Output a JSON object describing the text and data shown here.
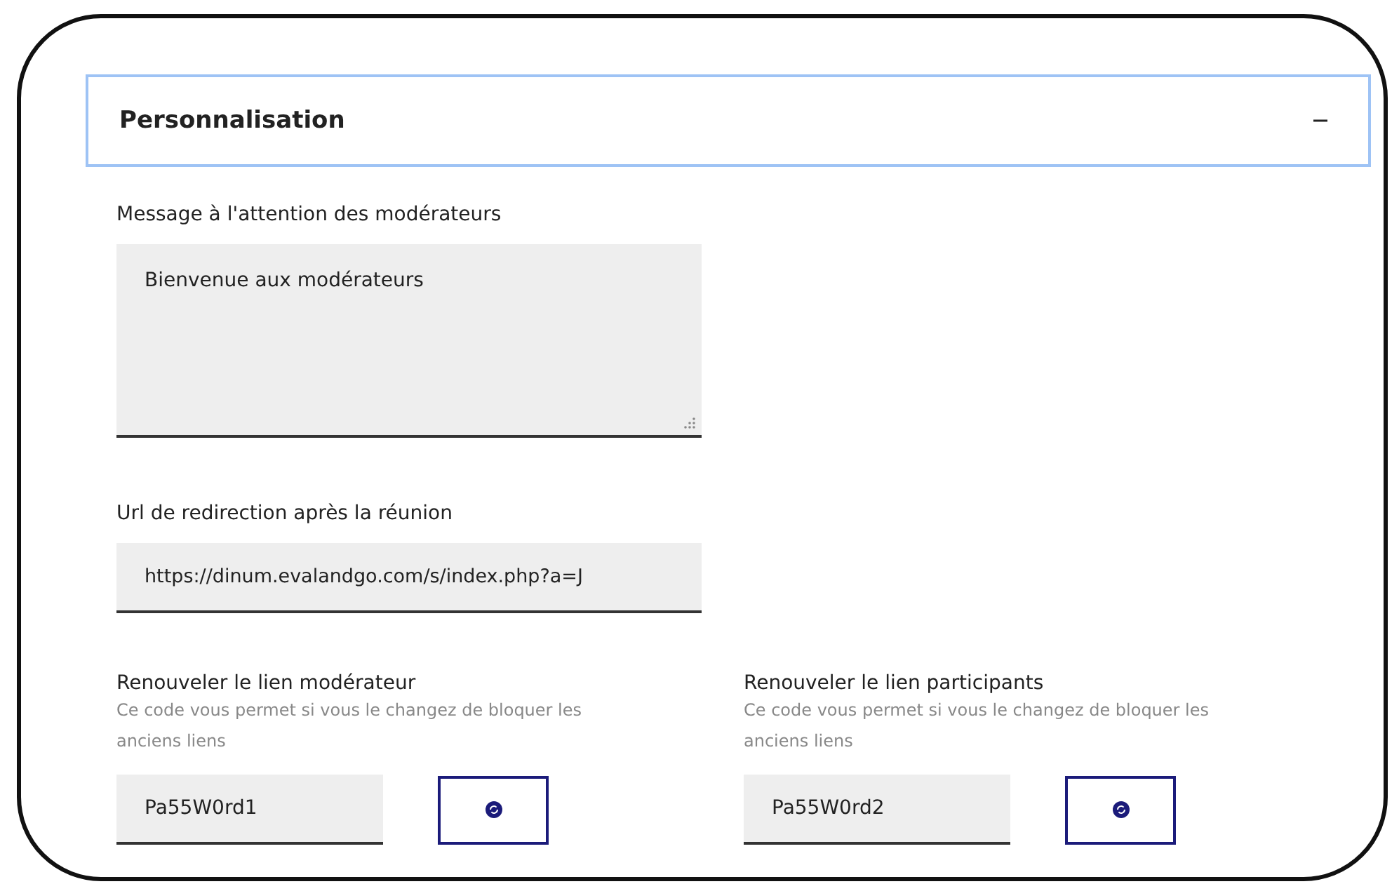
{
  "accordion": {
    "title": "Personnalisation",
    "expanded": true
  },
  "moderator_message": {
    "label": "Message à l'attention des modérateurs",
    "value": "Bienvenue aux modérateurs"
  },
  "redirect_url": {
    "label": "Url de redirection après la réunion",
    "value": "https://dinum.evalandgo.com/s/index.php?a=J"
  },
  "renew_links": [
    {
      "label": "Renouveler le lien modérateur",
      "hint": "Ce code vous permet si vous le changez de bloquer les anciens liens",
      "value": "Pa55W0rd1"
    },
    {
      "label": "Renouveler le lien participants",
      "hint": "Ce code vous permet si vous le changez de bloquer les anciens liens",
      "value": "Pa55W0rd2"
    }
  ]
}
